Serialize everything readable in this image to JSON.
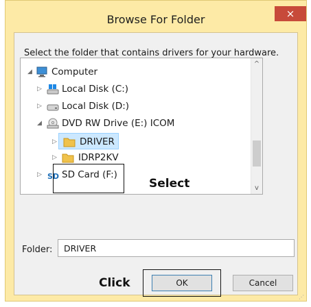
{
  "dialog": {
    "title": "Browse For Folder",
    "close_glyph": "×",
    "instruction": "Select the folder that contains drivers for your hardware."
  },
  "tree": {
    "items": [
      {
        "label": "Computer",
        "icon": "computer-icon",
        "expander": "expanded"
      },
      {
        "label": "Local Disk (C:)",
        "icon": "windows-drive-icon",
        "expander": "collapsed"
      },
      {
        "label": "Local Disk (D:)",
        "icon": "drive-icon",
        "expander": "collapsed"
      },
      {
        "label": "DVD RW Drive (E:) ICOM",
        "icon": "dvd-drive-icon",
        "expander": "expanded"
      },
      {
        "label": "DRIVER",
        "icon": "folder-icon",
        "expander": "collapsed",
        "selected": true
      },
      {
        "label": "IDRP2KV",
        "icon": "folder-icon",
        "expander": "collapsed"
      },
      {
        "label": "SD Card (F:)",
        "icon": "sd-card-icon",
        "expander": "collapsed"
      }
    ],
    "scroll_up_glyph": "^",
    "scroll_down_glyph": "v"
  },
  "annotations": {
    "select": "Select",
    "click": "Click"
  },
  "folder_field": {
    "label": "Folder:",
    "value": "DRIVER"
  },
  "buttons": {
    "ok": "OK",
    "cancel": "Cancel"
  },
  "colors": {
    "frame": "#fdeaa6",
    "close": "#c74a3a",
    "selection": "#cce8ff"
  }
}
